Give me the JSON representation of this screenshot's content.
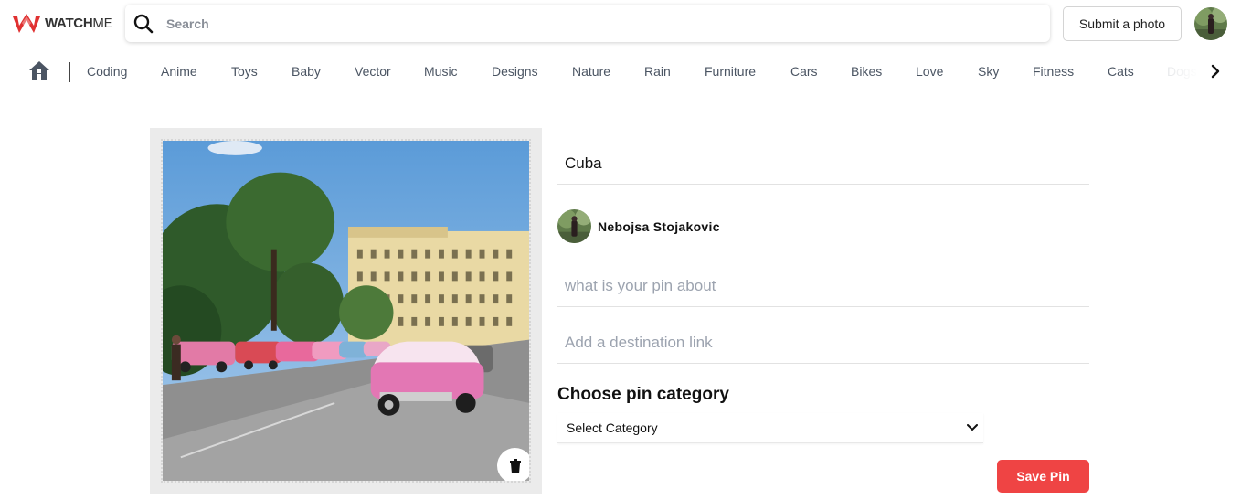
{
  "header": {
    "logo_text_bold": "WATCH",
    "logo_text_rest": "ME",
    "search_placeholder": "Search",
    "submit_label": "Submit a photo",
    "icons": {
      "logo": "watchme-logo",
      "search": "search-icon",
      "avatar": "user-avatar"
    }
  },
  "categories": {
    "items": [
      "Coding",
      "Anime",
      "Toys",
      "Baby",
      "Vector",
      "Music",
      "Designs",
      "Nature",
      "Rain",
      "Furniture",
      "Cars",
      "Bikes",
      "Love",
      "Sky",
      "Fitness",
      "Cats",
      "Dogs"
    ],
    "icons": {
      "home": "home-icon",
      "next": "chevron-right-icon"
    }
  },
  "pin": {
    "image_alt": "Pink vintage cars parked on a street in Havana with a yellow hotel and trees",
    "title_value": "Cuba",
    "user_name": "Nebojsa Stojakovic",
    "about_placeholder": "what is your pin about",
    "destination_placeholder": "Add a destination link",
    "category_heading": "Choose pin category",
    "category_selected": "Select Category",
    "save_label": "Save Pin",
    "icons": {
      "delete": "trash-icon",
      "dropdown": "chevron-down-icon"
    }
  },
  "colors": {
    "accent": "#ef4444",
    "logo_red": "#e03131",
    "panel_bg": "#ebebeb",
    "muted_text": "#4b5563"
  }
}
